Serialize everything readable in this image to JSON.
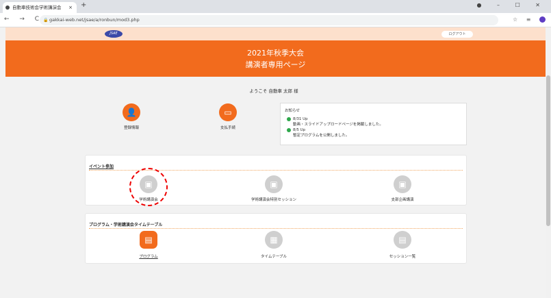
{
  "browser": {
    "tab_title": "自動車技術会学術講演会",
    "tab_close": "×",
    "new_tab": "+",
    "window_controls": "● – ☐ ✕",
    "nav_icons": "← → C ⌂",
    "url": "gakkai-web.net/jsae/a/ronbun/mod3.php",
    "toolbar_icons": "☆ ≡"
  },
  "site": {
    "logo_text": "JSAE",
    "logout_label": "ログアウト",
    "title_line1": "2021年秋季大会",
    "title_line2": "講演者専用ページ",
    "welcome": "ようこそ 自動車 太郎 様"
  },
  "quick_links": [
    {
      "label": "登録情報",
      "icon": "person-icon"
    },
    {
      "label": "支払手続",
      "icon": "credit-card-icon"
    }
  ],
  "news": {
    "heading": "お知らせ",
    "items": [
      {
        "date": "8/31 Up",
        "text": "動画・スライドアップロードページを掲載しました。"
      },
      {
        "date": "8/5 Up",
        "text": "暫定プログラムを公開しました。"
      }
    ]
  },
  "event_section": {
    "heading": "イベント参加",
    "items": [
      {
        "label": "学術講演会",
        "icon": "lecture-icon"
      },
      {
        "label": "学術講演会特別セッション",
        "icon": "presentation-icon"
      },
      {
        "label": "支部企画講演",
        "icon": "presentation-icon"
      }
    ]
  },
  "program_section": {
    "heading": "プログラム・学術講演会タイムテーブル",
    "items": [
      {
        "label": "プログラム",
        "icon": "book-icon"
      },
      {
        "label": "タイムテーブル",
        "icon": "calendar-icon"
      },
      {
        "label": "セッション一覧",
        "icon": "list-icon"
      }
    ]
  },
  "colors": {
    "accent": "#f26b1d",
    "disabled": "#cfcfcf",
    "annotation": "#e00000"
  }
}
